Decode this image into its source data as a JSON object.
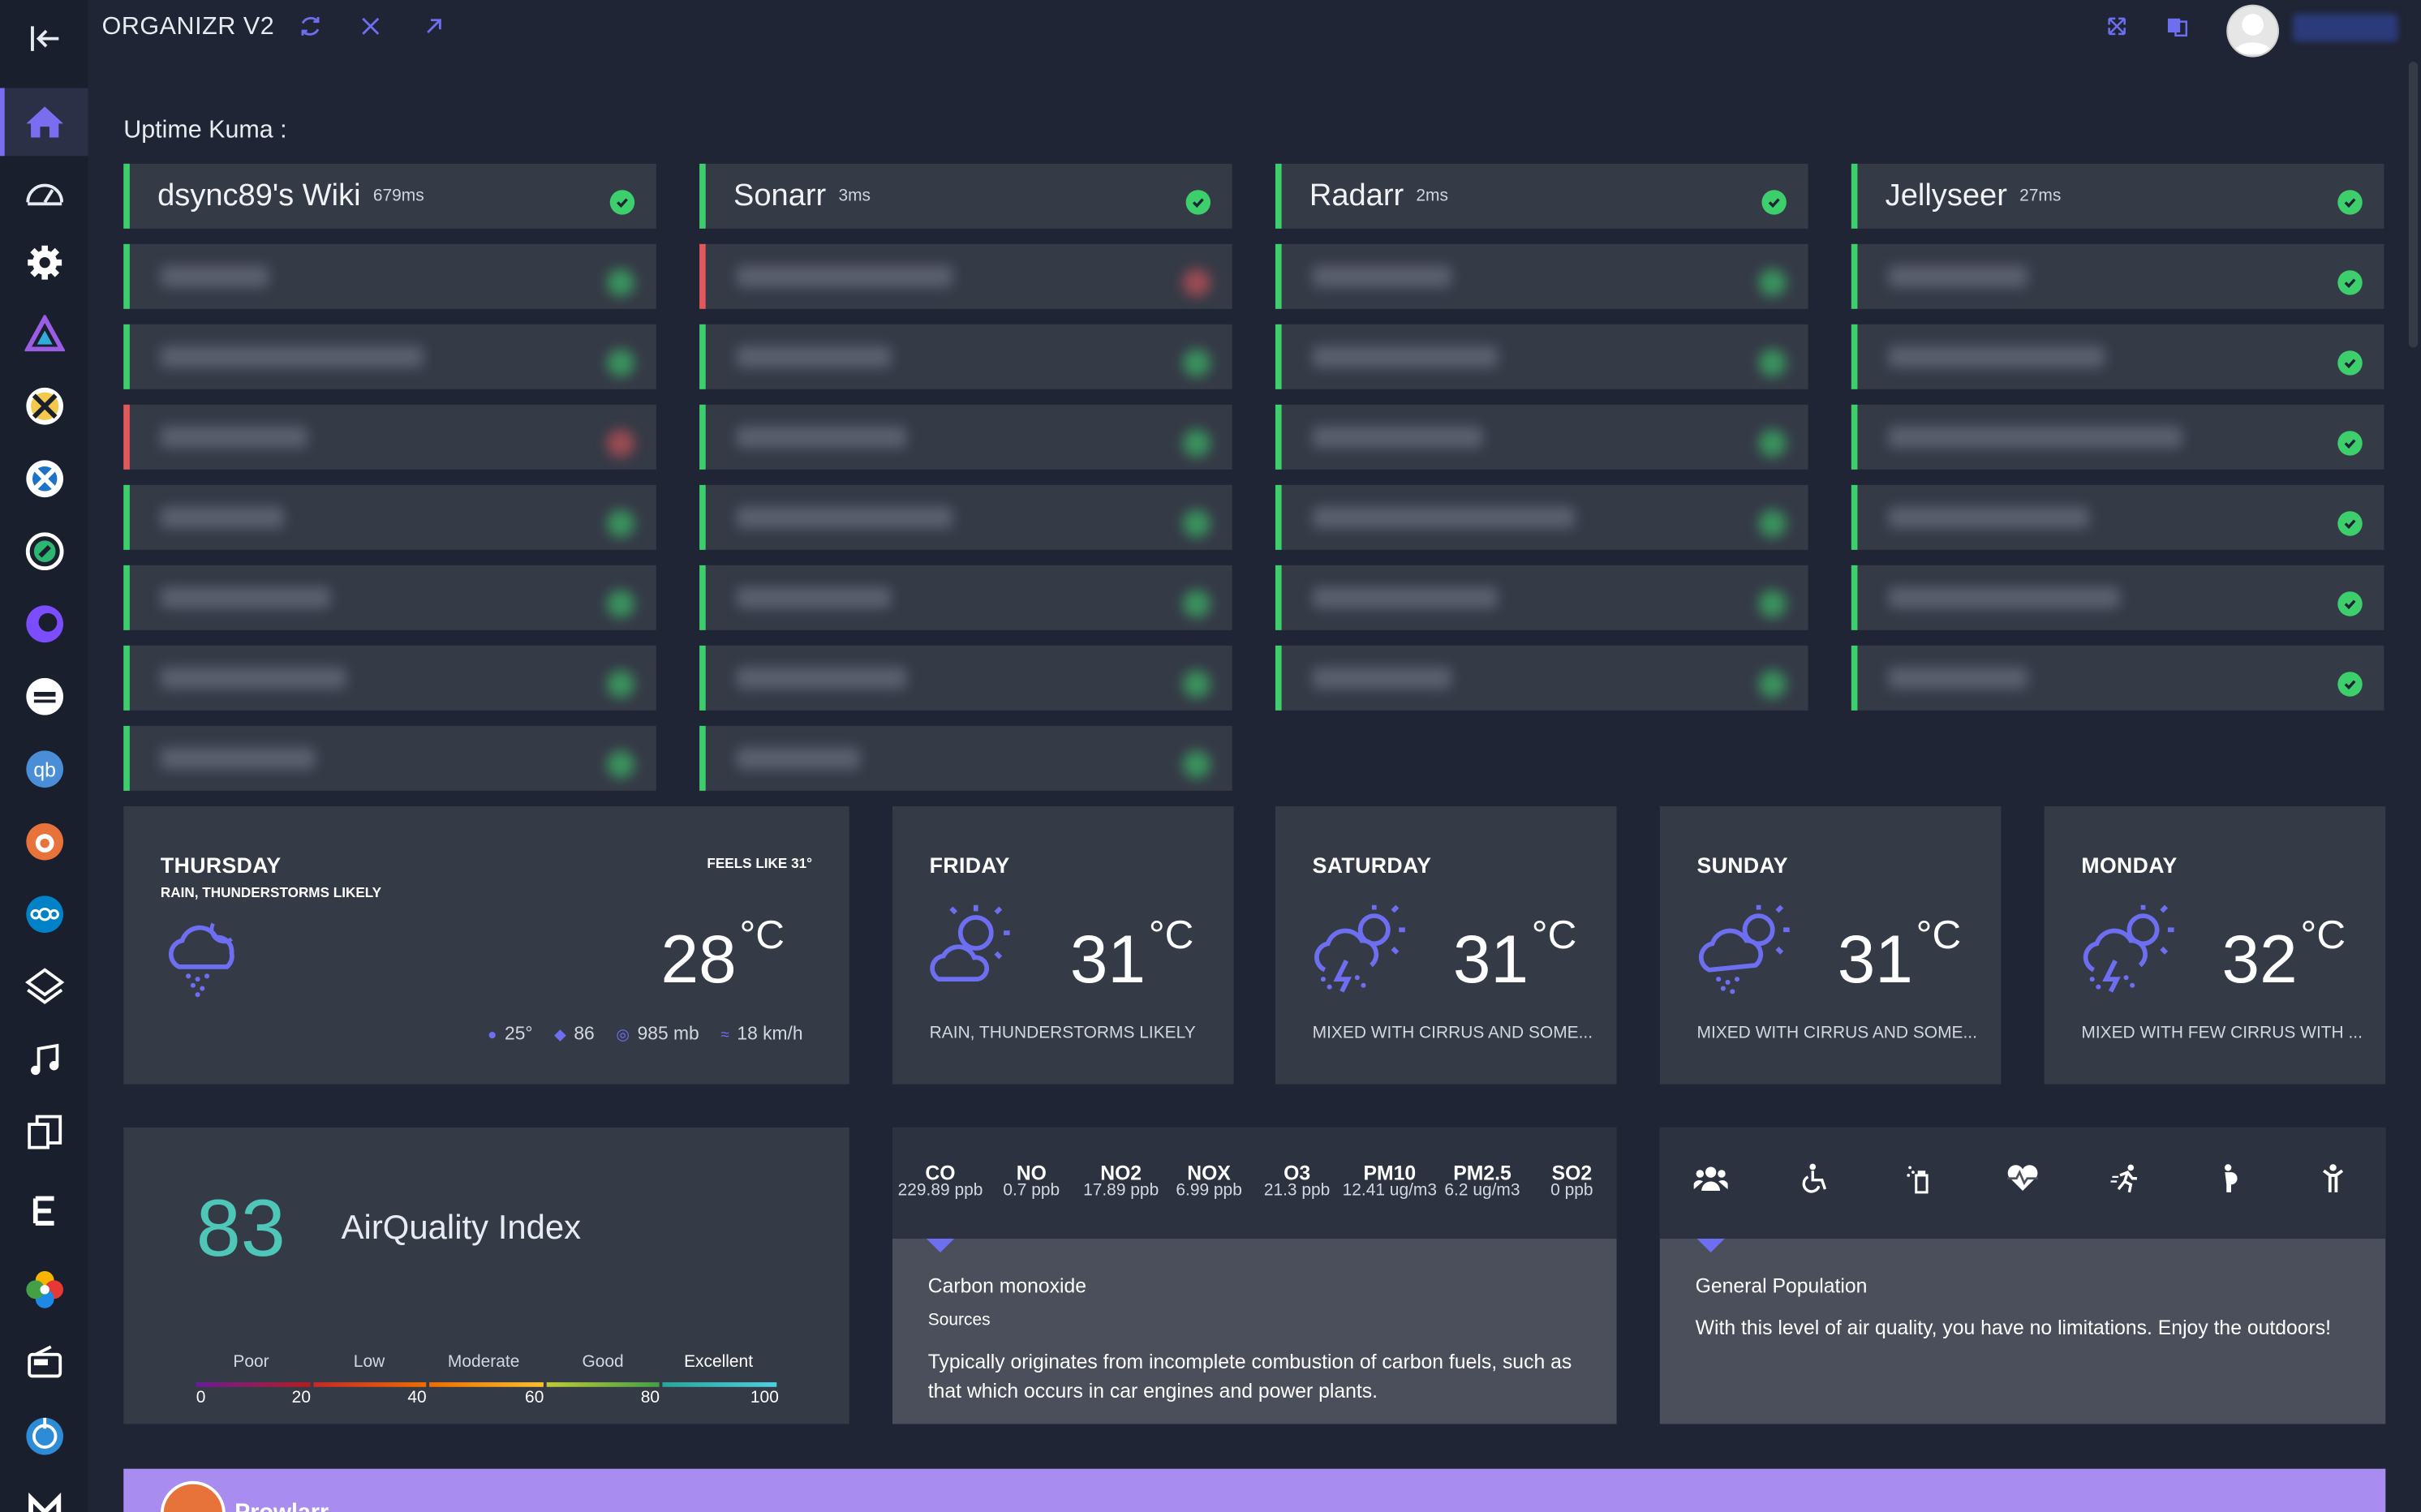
{
  "app": {
    "title": "ORGANIZR V2"
  },
  "sidebar": {
    "items": [
      {
        "icon": "collapse-icon"
      },
      {
        "icon": "home-icon"
      },
      {
        "icon": "speedometer-icon"
      },
      {
        "icon": "gear-icon"
      },
      {
        "icon": "jellyfin-icon"
      },
      {
        "icon": "sabnzbd-icon"
      },
      {
        "icon": "radarr-icon"
      },
      {
        "icon": "lidarr-icon"
      },
      {
        "icon": "overseerr-icon"
      },
      {
        "icon": "tv-icon"
      },
      {
        "icon": "qbittorrent-icon"
      },
      {
        "icon": "prowlarr-icon"
      },
      {
        "icon": "nextcloud-icon"
      },
      {
        "icon": "layers-icon"
      },
      {
        "icon": "music-icon"
      },
      {
        "icon": "docs-icon"
      },
      {
        "icon": "emby-icon"
      },
      {
        "icon": "photos-icon"
      },
      {
        "icon": "radio-icon"
      },
      {
        "icon": "globe-icon"
      },
      {
        "icon": "m-icon"
      }
    ]
  },
  "uptime": {
    "label": "Uptime Kuma :",
    "columns": [
      {
        "name": "dsync89's Wiki",
        "ms": "679ms"
      },
      {
        "name": "Sonarr",
        "ms": "3ms"
      },
      {
        "name": "Radarr",
        "ms": "2ms"
      },
      {
        "name": "Jellyseer",
        "ms": "27ms"
      }
    ]
  },
  "weather": [
    {
      "day": "THURSDAY",
      "sub": "RAIN, THUNDERSTORMS LIKELY",
      "feels": "FEELS LIKE 31°",
      "temp": "28",
      "unit": "°C",
      "stats": {
        "dew": "25°",
        "humidity": "86",
        "pressure": "985 mb",
        "wind": "18 km/h"
      }
    },
    {
      "day": "FRIDAY",
      "temp": "31",
      "unit": "°C",
      "desc": "RAIN, THUNDERSTORMS LIKELY"
    },
    {
      "day": "SATURDAY",
      "temp": "31",
      "unit": "°C",
      "desc": "MIXED WITH CIRRUS AND SOME..."
    },
    {
      "day": "SUNDAY",
      "temp": "31",
      "unit": "°C",
      "desc": "MIXED WITH CIRRUS AND SOME..."
    },
    {
      "day": "MONDAY",
      "temp": "32",
      "unit": "°C",
      "desc": "MIXED WITH FEW CIRRUS WITH ..."
    }
  ],
  "air": {
    "index": "83",
    "label": "AirQuality Index",
    "categories": [
      "Poor",
      "Low",
      "Moderate",
      "Good",
      "Excellent"
    ],
    "ticks": [
      "0",
      "20",
      "40",
      "60",
      "80",
      "100"
    ],
    "pollutants": [
      {
        "name": "CO",
        "value": "229.89 ppb"
      },
      {
        "name": "NO",
        "value": "0.7 ppb"
      },
      {
        "name": "NO2",
        "value": "17.89 ppb"
      },
      {
        "name": "NOX",
        "value": "6.99 ppb"
      },
      {
        "name": "O3",
        "value": "21.3 ppb"
      },
      {
        "name": "PM10",
        "value": "12.41 ug/m3"
      },
      {
        "name": "PM2.5",
        "value": "6.2 ug/m3"
      },
      {
        "name": "SO2",
        "value": "0 ppb"
      }
    ],
    "selected": {
      "name": "Carbon monoxide",
      "sources_label": "Sources",
      "text": "Typically originates from incomplete combustion of carbon fuels, such as that which occurs in car engines and power plants."
    },
    "population": {
      "icons": [
        "group-icon",
        "wheelchair-icon",
        "inhaler-icon",
        "heart-icon",
        "runner-icon",
        "pregnant-icon",
        "child-icon"
      ],
      "name": "General Population",
      "text": "With this level of air quality, you have no limitations. Enjoy the outdoors!"
    }
  },
  "footer_bar": {
    "title": "Prowlarr"
  }
}
